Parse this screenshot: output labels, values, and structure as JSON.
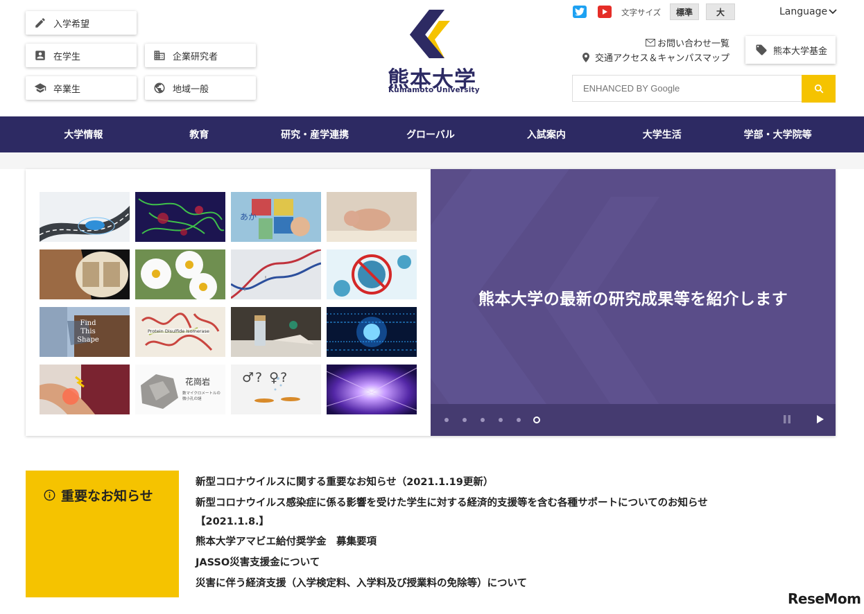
{
  "audience": {
    "applicants": "入学希望",
    "students": "在学生",
    "researchers": "企業研究者",
    "alumni": "卒業生",
    "community": "地域一般"
  },
  "logo": {
    "name_ja": "熊本大学",
    "name_en": "Kumamoto University",
    "colors": {
      "navy": "#2d2a63",
      "gold": "#f5c300"
    }
  },
  "utility": {
    "font_size_label": "文字サイズ",
    "font_size_standard": "標準",
    "font_size_large": "大",
    "language": "Language",
    "contact": "お問い合わせ一覧",
    "access": "交通アクセス＆キャンパスマップ",
    "fund": "熊本大学基金",
    "search_placeholder": "ENHANCED BY Google"
  },
  "nav": [
    "大学情報",
    "教育",
    "研究・産学連携",
    "グローバル",
    "入試案内",
    "大学生活",
    "学部・大学院等"
  ],
  "slider": {
    "message": "熊本大学の最新の研究成果等を紹介します",
    "dot_count": 6,
    "active_dot": 6,
    "tiles": {
      "find_shape": "Find This Shape",
      "pdi": "Protein Disulfide Isomerase",
      "a_ka": "あか",
      "granite_title": "花崗岩",
      "granite_sub": "数マイクロメートルの微小孔の謎",
      "symbols": "♂? ♀?"
    }
  },
  "notices": {
    "title": "重要なお知らせ",
    "items": [
      "新型コロナウイルスに関する重要なお知らせ（2021.1.19更新）",
      "新型コロナウイルス感染症に係る影響を受けた学生に対する経済的支援等を含む各種サポートについてのお知らせ",
      "【2021.1.8.】",
      "熊本大学アマビエ給付奨学金　募集要項",
      "JASSO災害支援金について",
      "災害に伴う経済支援（入学検定料、入学料及び授業料の免除等）について"
    ]
  },
  "watermark": "ReseMom"
}
